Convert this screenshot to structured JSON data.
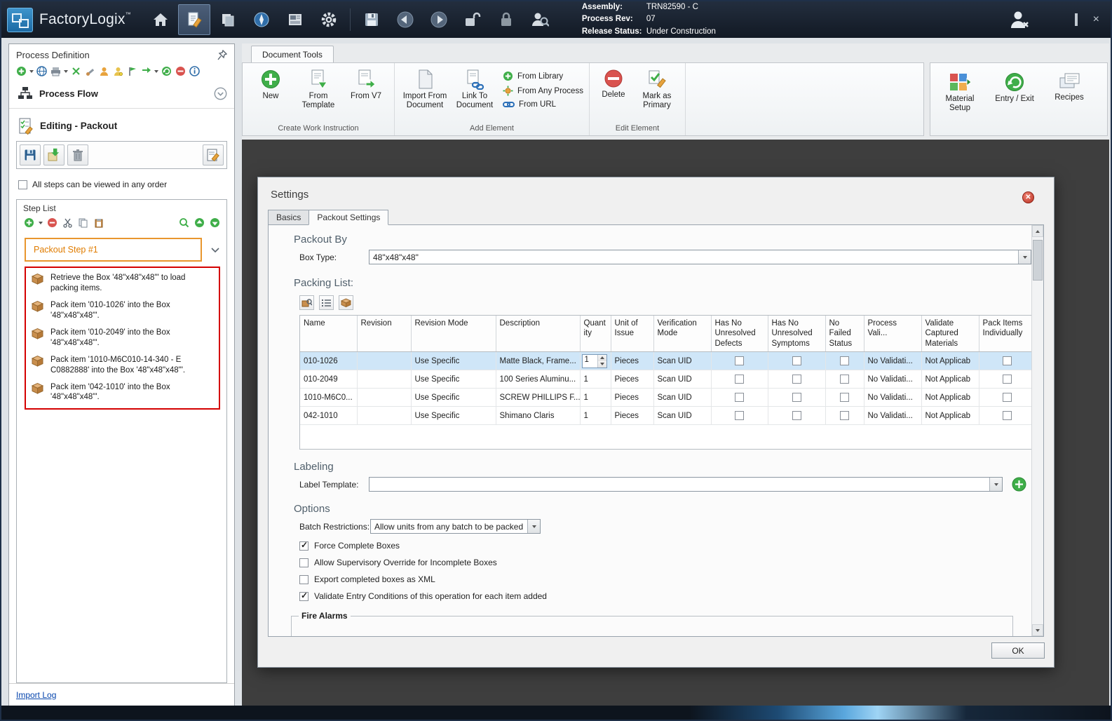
{
  "window": {
    "app_name": "FactoryLogix",
    "assembly_label": "Assembly:",
    "assembly_value": "TRN82590 - C",
    "process_rev_label": "Process Rev:",
    "process_rev_value": "07",
    "release_status_label": "Release Status:",
    "release_status_value": "Under Construction"
  },
  "sidebar": {
    "title": "Process Definition",
    "process_flow_label": "Process Flow",
    "editing_label": "Editing - Packout",
    "order_checkbox_label": "All steps can be viewed in any order",
    "step_list_label": "Step List",
    "selected_step": "Packout Step #1",
    "steps": [
      "Retrieve the Box '48\"x48\"x48\"' to load packing items.",
      "Pack item '010-1026' into the Box '48\"x48\"x48\"'.",
      "Pack item '010-2049' into the Box '48\"x48\"x48\"'.",
      "Pack item '1010-M6C010-14-340 - E      C0882888' into the Box '48\"x48\"x48\"'.",
      "Pack item '042-1010' into the Box '48\"x48\"x48\"'."
    ],
    "import_log_label": "Import Log"
  },
  "ribbon": {
    "tab_label": "Document Tools",
    "create_group": {
      "label": "Create Work Instruction",
      "new": "New",
      "from_template": "From Template",
      "from_v7": "From V7"
    },
    "add_group": {
      "label": "Add Element",
      "import_from_document": "Import From Document",
      "link_to_document": "Link To Document",
      "from_library": "From Library",
      "from_any_process": "From Any Process",
      "from_url": "From URL"
    },
    "edit_group": {
      "label": "Edit Element",
      "delete": "Delete",
      "mark_as_primary": "Mark as Primary"
    },
    "right_buttons": {
      "material_setup": "Material Setup",
      "entry_exit": "Entry / Exit",
      "recipes": "Recipes"
    }
  },
  "dialog": {
    "title": "Settings",
    "tabs": {
      "basics": "Basics",
      "packout": "Packout Settings"
    },
    "packout_by": {
      "heading": "Packout By",
      "box_type_label": "Box Type:",
      "box_type_value": "48\"x48\"x48\""
    },
    "packing_list": {
      "heading": "Packing List:",
      "columns": [
        "Name",
        "Revision",
        "Revision Mode",
        "Description",
        "Quantity",
        "Unit of Issue",
        "Verification Mode",
        "Has No Unresolved Defects",
        "Has No Unresolved Symptoms",
        "No Failed Status",
        "Process Vali...",
        "Validate Captured Materials",
        "Pack Items Individually"
      ],
      "rows": [
        {
          "name": "010-1026",
          "revision": "",
          "revision_mode": "Use Specific",
          "description": "Matte Black, Frame...",
          "quantity": "1",
          "unit": "Pieces",
          "verification": "Scan UID",
          "process_validation": "No Validati...",
          "validate_captured": "Not Applicab"
        },
        {
          "name": "010-2049",
          "revision": "",
          "revision_mode": "Use Specific",
          "description": "100 Series Aluminu...",
          "quantity": "1",
          "unit": "Pieces",
          "verification": "Scan UID",
          "process_validation": "No Validati...",
          "validate_captured": "Not Applicab"
        },
        {
          "name": "1010-M6C0...",
          "revision": "",
          "revision_mode": "Use Specific",
          "description": "SCREW PHILLIPS F...",
          "quantity": "1",
          "unit": "Pieces",
          "verification": "Scan UID",
          "process_validation": "No Validati...",
          "validate_captured": "Not Applicab"
        },
        {
          "name": "042-1010",
          "revision": "",
          "revision_mode": "Use Specific",
          "description": "Shimano Claris",
          "quantity": "1",
          "unit": "Pieces",
          "verification": "Scan UID",
          "process_validation": "No Validati...",
          "validate_captured": "Not Applicab"
        }
      ]
    },
    "labeling": {
      "heading": "Labeling",
      "label_template_label": "Label Template:",
      "label_template_value": ""
    },
    "options": {
      "heading": "Options",
      "batch_restrictions_label": "Batch Restrictions:",
      "batch_restrictions_value": "Allow units from any batch to be packed",
      "checkboxes": [
        {
          "label": "Force Complete Boxes",
          "checked": true
        },
        {
          "label": "Allow Supervisory Override for Incomplete Boxes",
          "checked": false
        },
        {
          "label": "Export completed boxes as XML",
          "checked": false
        },
        {
          "label": "Validate Entry Conditions of this operation for each item added",
          "checked": true
        }
      ]
    },
    "fire_alarms_label": "Fire Alarms",
    "ok_label": "OK"
  },
  "colors": {
    "selected_step_border": "#e8962e",
    "step_list_outline": "#d40000",
    "selected_row": "#cfe6f8",
    "titlebar": "#141b26"
  }
}
